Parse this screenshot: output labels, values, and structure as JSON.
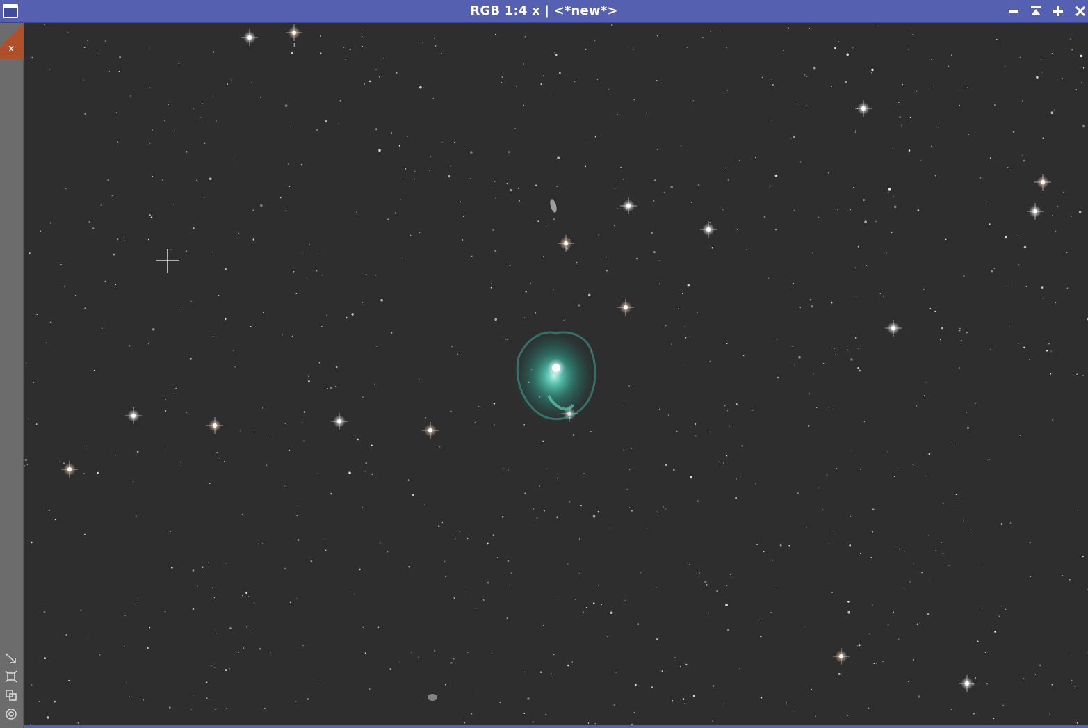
{
  "window": {
    "title": "RGB 1:4 x | <*new*>",
    "accent_color": "#5560b0",
    "background_color": "#2e2e2e"
  },
  "titlebar_buttons": {
    "minimize_icon": "minimize-icon",
    "shade_icon": "shade-up-icon",
    "maximize_icon": "maximize-icon",
    "close_icon": "close-icon"
  },
  "sidebar": {
    "close_tab_label": "x",
    "tools": [
      {
        "icon": "zoom-to-fit-icon"
      },
      {
        "icon": "fit-view-icon"
      },
      {
        "icon": "clone-view-icon"
      },
      {
        "icon": "mask-circle-icon"
      }
    ]
  },
  "image": {
    "subject": "starfield with planetary nebula",
    "nebula_color": "#2fb9a5",
    "cursor": "crosshair-icon"
  }
}
